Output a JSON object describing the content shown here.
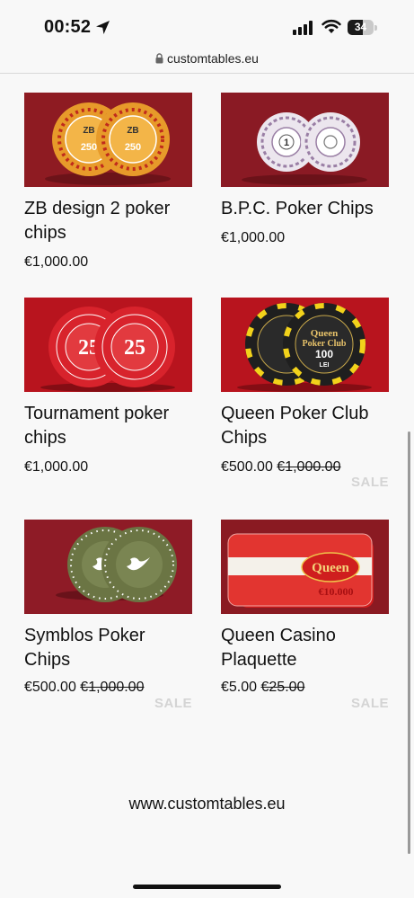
{
  "status": {
    "time": "00:52",
    "battery": "34",
    "icons": [
      "location-arrow-icon",
      "signal-icon",
      "wifi-icon",
      "battery-icon"
    ]
  },
  "browser": {
    "url": "customtables.eu",
    "icon": "lock-icon"
  },
  "products": [
    {
      "name": "ZB design 2 poker chips",
      "price": "€1,000.00"
    },
    {
      "name": "B.P.C. Poker Chips",
      "price": "€1,000.00"
    },
    {
      "name": "Tournament poker chips",
      "price": "€1,000.00"
    },
    {
      "name": "Queen Poker Club Chips",
      "price": "€500.00",
      "old_price": "€1,000.00",
      "badge": "SALE"
    },
    {
      "name": "Symblos Poker Chips",
      "price": "€500.00",
      "old_price": "€1,000.00",
      "badge": "SALE"
    },
    {
      "name": "Queen Casino Plaquette",
      "price": "€5.00",
      "old_price": "€25.00",
      "badge": "SALE"
    }
  ],
  "images": {
    "zb": {
      "denomination": "250"
    },
    "bpc": {
      "denomination": "1"
    },
    "tournament": {
      "denomination": "25"
    },
    "queen_club": {
      "line1": "Queen",
      "line2": "Poker Club",
      "denomination": "100",
      "unit": "LEI"
    },
    "plaquette": {
      "brand": "Queen",
      "value": "€10.000"
    }
  },
  "footer": {
    "url": "www.customtables.eu"
  },
  "colors": {
    "background": "#f8f8f8",
    "photo_red": "#8e1b22",
    "sale_badge": "#d4d4d4",
    "chip_orange": "#e79a2a",
    "chip_black": "#1f1f1f",
    "chip_green": "#6b7544"
  }
}
